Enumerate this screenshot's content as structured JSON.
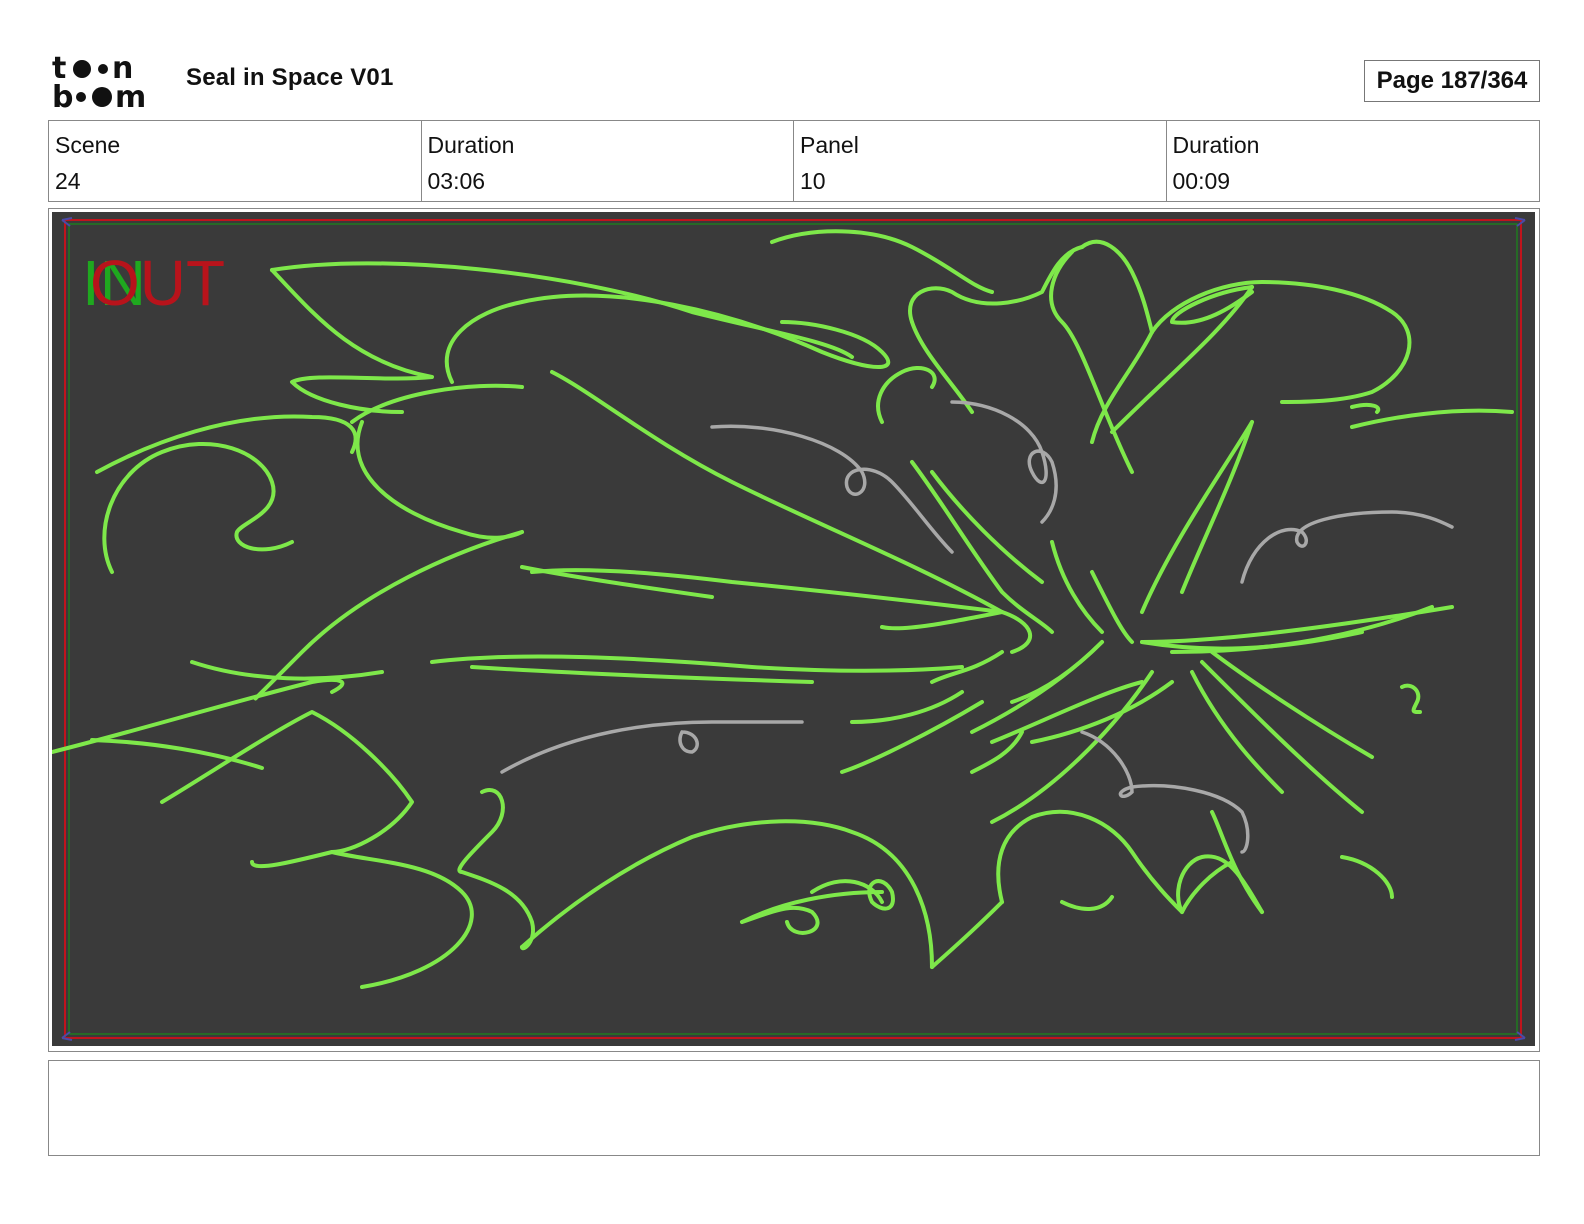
{
  "header": {
    "logo_line1": "toon",
    "logo_line2": "boom",
    "project_title": "Seal in Space V01",
    "page_label": "Page 187/364"
  },
  "info": {
    "scene_label": "Scene",
    "scene_value": "24",
    "scene_duration_label": "Duration",
    "scene_duration_value": "03:06",
    "panel_label": "Panel",
    "panel_value": "10",
    "panel_duration_label": "Duration",
    "panel_duration_value": "00:09"
  },
  "panel": {
    "transition_in": "IN",
    "transition_out": "OUT",
    "background_color": "#3a3a3a",
    "sketch_color": "#7ee84a",
    "secondary_sketch_color": "#a8a8a8",
    "safe_frame_color": "#c0141c"
  },
  "notes": {
    "text": ""
  }
}
